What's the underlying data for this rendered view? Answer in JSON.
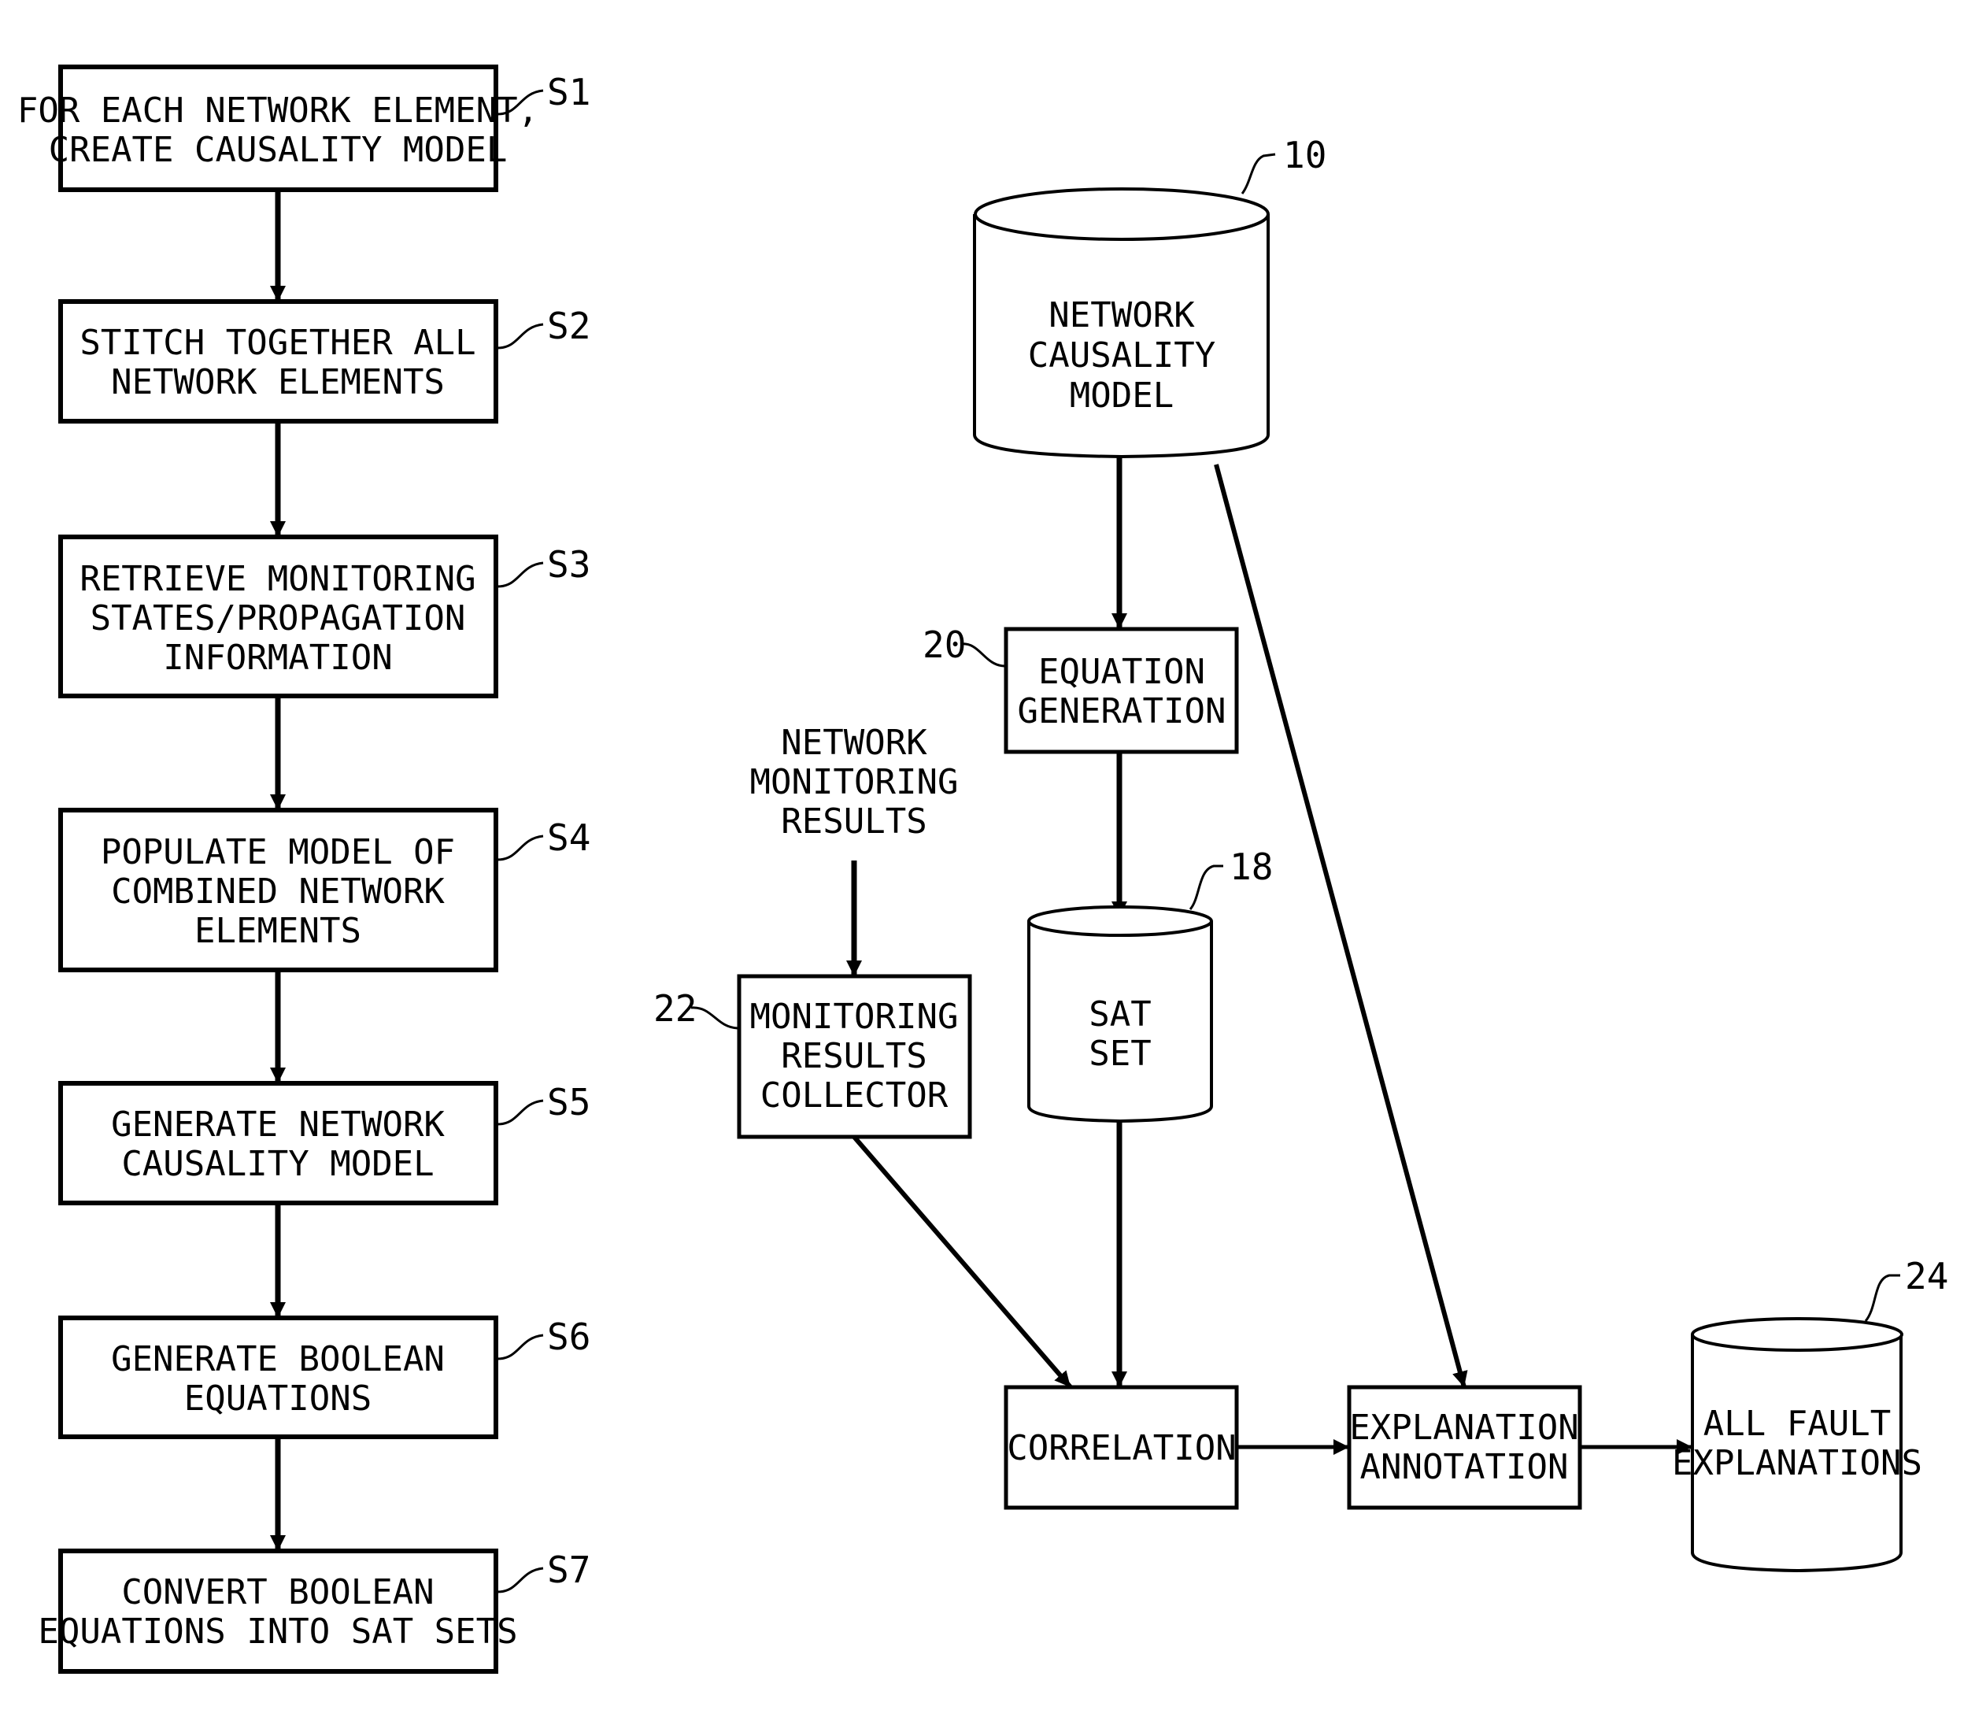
{
  "flowchart": {
    "steps": [
      {
        "id": "S1",
        "lines": [
          "FOR EACH NETWORK ELEMENT,",
          "CREATE CAUSALITY MODEL"
        ]
      },
      {
        "id": "S2",
        "lines": [
          "STITCH TOGETHER ALL",
          "NETWORK ELEMENTS"
        ]
      },
      {
        "id": "S3",
        "lines": [
          "RETRIEVE MONITORING",
          "STATES/PROPAGATION",
          "INFORMATION"
        ]
      },
      {
        "id": "S4",
        "lines": [
          "POPULATE MODEL OF",
          "COMBINED NETWORK",
          "ELEMENTS"
        ]
      },
      {
        "id": "S5",
        "lines": [
          "GENERATE NETWORK",
          "CAUSALITY MODEL"
        ]
      },
      {
        "id": "S6",
        "lines": [
          "GENERATE BOOLEAN",
          "EQUATIONS"
        ]
      },
      {
        "id": "S7",
        "lines": [
          "CONVERT BOOLEAN",
          "EQUATIONS INTO SAT SETS"
        ]
      }
    ]
  },
  "system": {
    "network_causality_model": {
      "ref": "10",
      "lines": [
        "NETWORK",
        "CAUSALITY",
        "MODEL"
      ]
    },
    "equation_generation": {
      "ref": "20",
      "lines": [
        "EQUATION",
        "GENERATION"
      ]
    },
    "network_monitoring_results": {
      "lines": [
        "NETWORK",
        "MONITORING",
        "RESULTS"
      ]
    },
    "monitoring_results_collector": {
      "ref": "22",
      "lines": [
        "MONITORING",
        "RESULTS",
        "COLLECTOR"
      ]
    },
    "sat_set": {
      "ref": "18",
      "lines": [
        "SAT",
        "SET"
      ]
    },
    "correlation": {
      "lines": [
        "CORRELATION"
      ]
    },
    "explanation_annotation": {
      "lines": [
        "EXPLANATION",
        "ANNOTATION"
      ]
    },
    "all_fault_explanations": {
      "ref": "24",
      "lines": [
        "ALL FAULT",
        "EXPLANATIONS"
      ]
    }
  }
}
